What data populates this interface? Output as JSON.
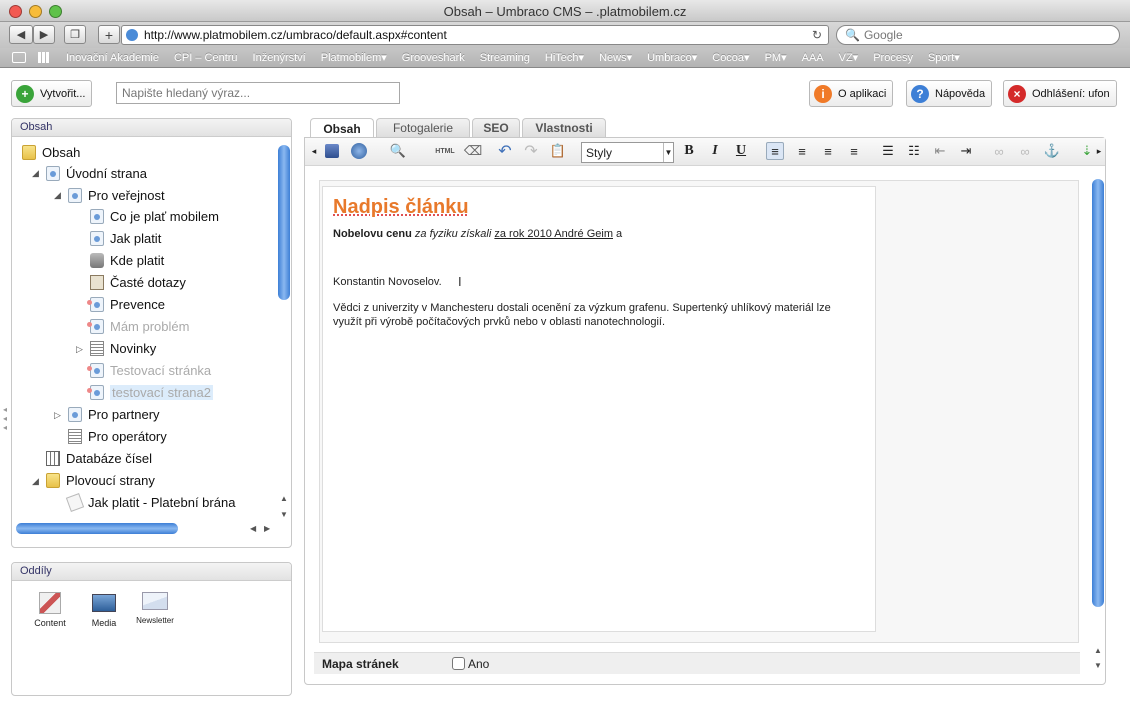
{
  "window": {
    "title": "Obsah – Umbraco CMS – .platmobilem.cz"
  },
  "browser": {
    "url": "http://www.platmobilem.cz/umbraco/default.aspx#content",
    "search_placeholder": "Google",
    "bookmarks": [
      "Inovační Akademie",
      "CPI – Centru",
      "Inženýrství",
      "Platmobilem▾",
      "Grooveshark",
      "Streaming",
      "HiTech▾",
      "News▾",
      "Umbraco▾",
      "Cocoa▾",
      "PM▾",
      "AAA",
      "VZ▾",
      "Procesy",
      "Sport▾"
    ]
  },
  "header": {
    "create_label": "Vytvořit...",
    "search_placeholder": "Napište hledaný výraz...",
    "about_label": "O aplikaci",
    "help_label": "Nápověda",
    "logout_label": "Odhlášení: ufon"
  },
  "tree": {
    "panel_title": "Obsah",
    "nodes": [
      {
        "label": "Obsah"
      },
      {
        "label": "Úvodní strana"
      },
      {
        "label": "Pro veřejnost"
      },
      {
        "label": "Co je plať mobilem"
      },
      {
        "label": "Jak platit"
      },
      {
        "label": "Kde platit"
      },
      {
        "label": "Časté dotazy"
      },
      {
        "label": "Prevence"
      },
      {
        "label": "Mám problém"
      },
      {
        "label": "Novinky"
      },
      {
        "label": "Testovací stránka"
      },
      {
        "label": "testovací strana2"
      },
      {
        "label": "Pro partnery"
      },
      {
        "label": "Pro operátory"
      },
      {
        "label": "Databáze čísel"
      },
      {
        "label": "Plovoucí strany"
      },
      {
        "label": "Jak platit - Platební brána"
      }
    ]
  },
  "sections": {
    "panel_title": "Oddíly",
    "items": [
      {
        "label": "Content"
      },
      {
        "label": "Media"
      },
      {
        "label": "Newsletter"
      }
    ]
  },
  "editor": {
    "tabs": [
      "Obsah",
      "Fotogalerie",
      "SEO",
      "Vlastnosti"
    ],
    "style_select": "Styly",
    "heading": "Nadpis článku",
    "p1_bold": "Nobelovu cenu",
    "p1_italic": " za fyziku získali ",
    "p1_underline": "za rok 2010 André Geim",
    "p1_end": " a",
    "p2": "Konstantin Novoselov.",
    "p3": "Vědci z univerzity v Manchesteru dostali ocenění za výzkum grafenu. Supertenký uhlíkový materiál lze využít při výrobě počítačových prvků nebo v oblasti nanotechnologií.",
    "sitemap_label": "Mapa stránek",
    "sitemap_checkbox": "Ano"
  },
  "colors": {
    "heading": "#e8792b",
    "accent": "#3d7fd6"
  }
}
